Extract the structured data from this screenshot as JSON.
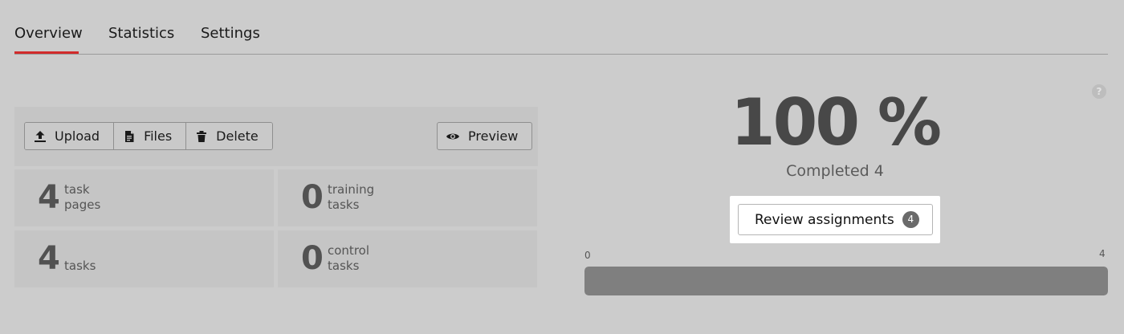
{
  "tabs": [
    {
      "label": "Overview",
      "active": true
    },
    {
      "label": "Statistics",
      "active": false
    },
    {
      "label": "Settings",
      "active": false
    }
  ],
  "toolbar": {
    "upload_label": "Upload",
    "files_label": "Files",
    "delete_label": "Delete",
    "preview_label": "Preview"
  },
  "stats": [
    {
      "value": "4",
      "label": "task\npages"
    },
    {
      "value": "0",
      "label": "training\ntasks"
    },
    {
      "value": "4",
      "label": "tasks"
    },
    {
      "value": "0",
      "label": "control\ntasks"
    }
  ],
  "progress": {
    "percent_text": "100 %",
    "completed_text": "Completed 4",
    "review_label": "Review assignments",
    "review_count": "4",
    "axis_min": "0",
    "axis_max": "4",
    "fill_fraction": 1.0
  },
  "help": {
    "icon": "question-icon",
    "glyph": "?"
  },
  "colors": {
    "accent_tab_underline": "#d12b2b",
    "progress_fill": "#7f7f7f",
    "badge_bg": "#6a6a6a"
  }
}
